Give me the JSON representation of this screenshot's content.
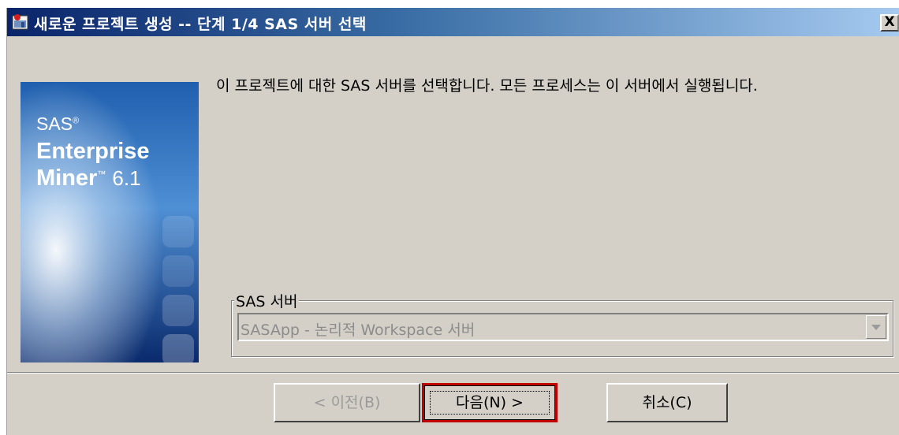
{
  "window": {
    "title": "새로운 프로젝트 생성 -- 단계 1/4 SAS 서버 선택",
    "close_label": "X"
  },
  "banner": {
    "brand_sas": "SAS",
    "brand_registered": "®",
    "brand_enterprise": "Enterprise",
    "brand_miner": "Miner",
    "brand_tm": "™",
    "brand_version": "6.1",
    "colors": {
      "top": "#1f5fae",
      "mid": "#4f8fd4",
      "bottom": "#0a2a6c"
    }
  },
  "description": "이 프로젝트에 대한 SAS 서버를 선택합니다. 모든 프로세스는 이 서버에서 실행됩니다.",
  "server_group": {
    "label": "SAS 서버",
    "selected_value": "SASApp - 논리적 Workspace 서버"
  },
  "buttons": {
    "back": "< 이전(B)",
    "next": "다음(N) >",
    "cancel": "취소(C)"
  },
  "colors": {
    "title_start": "#0a246a",
    "title_end": "#a6caf0",
    "face": "#d4d0c8",
    "highlight": "#c00000"
  }
}
